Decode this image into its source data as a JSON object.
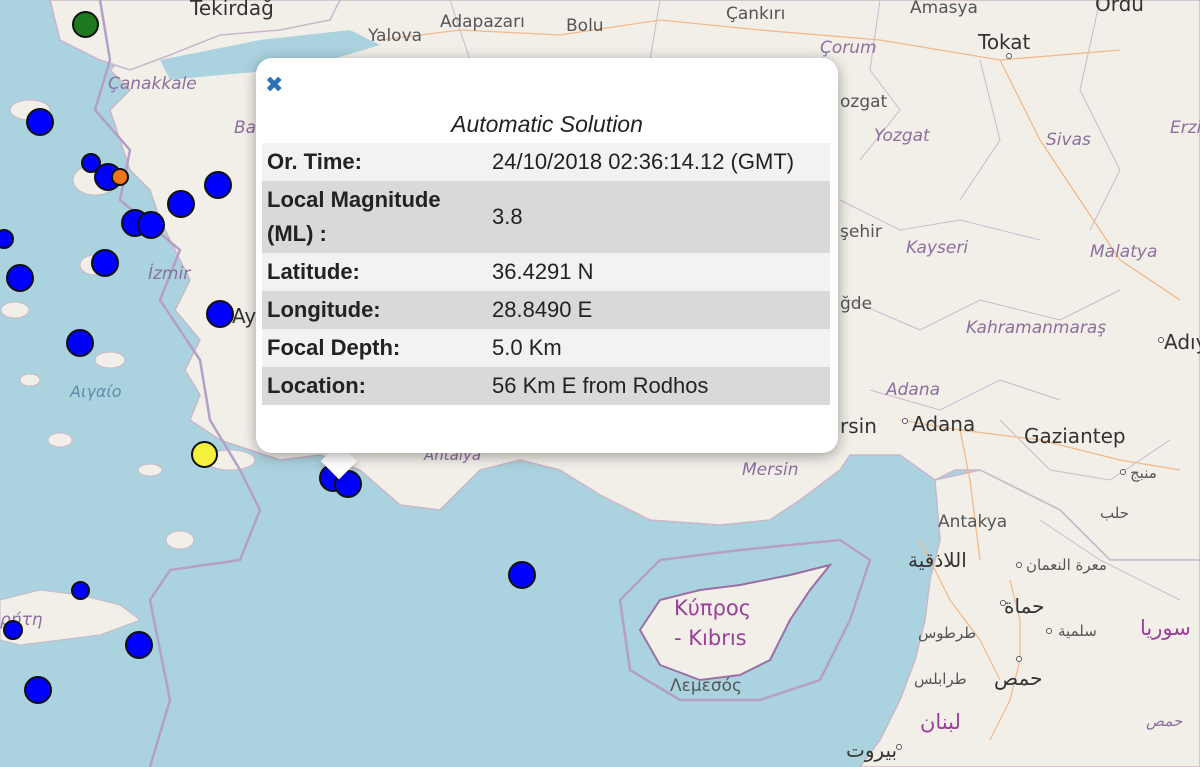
{
  "map": {
    "labels": {
      "tekirdag": "Tekirdağ",
      "adapazari": "Adapazarı",
      "cankiri": "Çankırı",
      "amasya": "Amasya",
      "ordu": "Ordu",
      "yalova": "Yalova",
      "bolu": "Bolu",
      "corum": "Çorum",
      "tokat": "Tokat",
      "canakkale": "Çanakkale",
      "ba": "Ba",
      "yozgat_frag": "ozgat",
      "yozgat": "Yozgat",
      "sivas": "Sivas",
      "erzi": "Erzi",
      "sehir": "şehir",
      "kayseri": "Kayseri",
      "malatya": "Malatya",
      "izmir": "İzmir",
      "ay": "Ay",
      "nigde": "ğde",
      "kahramanmaras": "Kahramanmaraş",
      "adiy": "Adıy",
      "aigaio": "Αιγαίο",
      "adana_region": "Adana",
      "mersin_frag": "rsin",
      "adana": "Adana",
      "gaziantep": "Gaziantep",
      "antalya": "Antalya",
      "mersin": "Mersin",
      "manbij": "منبج",
      "halab": "حلب",
      "antakya": "Antakya",
      "latakia": "اللاذقية",
      "maarat": "معرة النعمان",
      "kypros": "Κύπρος",
      "kibris": "- Kıbrıs",
      "hama": "حماة",
      "tartus": "طرطوس",
      "salamiyah": "سلمية",
      "suriya": "سوريا",
      "kriti": "ρήτη",
      "lemesos": "Λεμεσός",
      "homs_city": "حمص",
      "tripoli": "طرابلس",
      "lubnan": "لبنان",
      "homs_region": "حمص",
      "beirut": "بيروت"
    },
    "marker_colors": {
      "blue": "#0000ff",
      "green": "#1f7a1f",
      "orange": "#f0741e",
      "yellow": "#f4f03c"
    }
  },
  "popup": {
    "close_icon": "✖",
    "title": "Automatic Solution",
    "rows": [
      {
        "key": "Or. Time:",
        "value": "24/10/2018 02:36:14.12 (GMT)"
      },
      {
        "key": "Local Magnitude (ML) :",
        "value": "3.8"
      },
      {
        "key": "Latitude:",
        "value": "36.4291 N"
      },
      {
        "key": "Longitude:",
        "value": "28.8490 E"
      },
      {
        "key": "Focal Depth:",
        "value": "5.0 Km"
      },
      {
        "key": "Location:",
        "value": "56 Km E from Rodhos"
      }
    ]
  }
}
